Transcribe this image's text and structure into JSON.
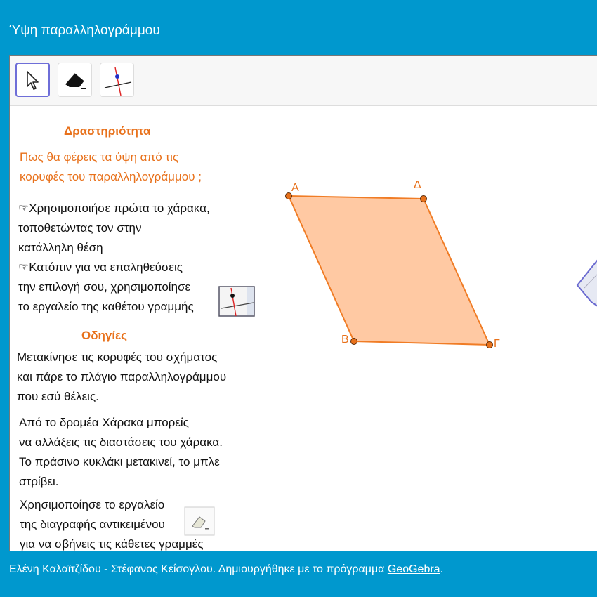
{
  "window": {
    "title": "Ύψη παραλληλογράμμου"
  },
  "toolbar": {
    "tools": [
      {
        "name": "move-tool",
        "icon": "arrow-cursor-icon"
      },
      {
        "name": "delete-tool",
        "icon": "eraser-icon"
      },
      {
        "name": "perpendicular-line-tool",
        "icon": "perpendicular-line-icon"
      }
    ]
  },
  "panel": {
    "heading": "Δραστηριότητα",
    "question_line1": "Πως θα φέρεις τα ύψη από τις",
    "question_line2": "κορυφές του παραλληλογράμμου ;",
    "steps": [
      "☞Χρησιμοποιήσε πρώτα το χάρακα,",
      "τοποθετώντας τον στην",
      "κατάλληλη θέση",
      "☞Κατόπιν για να επαληθεύσεις",
      "την επιλογή σου, χρησιμοποίησε",
      "το εργαλείο της καθέτου γραμμής"
    ],
    "instructions_heading": "Οδηγίες",
    "instr1": [
      "Μετακίνησε τις κορυφές του σχήματος",
      "και πάρε το πλάγιο παραλληλογράμμου",
      "που εσύ θέλεις."
    ],
    "instr2": [
      "Από το δρομέα Χάρακα μπορείς",
      "να αλλάξεις τις διαστάσεις του χάρακα.",
      "Το πράσινο κυκλάκι μετακινεί, το μπλε",
      "στρίβει."
    ],
    "instr3": [
      "Χρησιμοποίησε το εργαλείο",
      "της διαγραφής αντικειμένου",
      "για να σβήνεις τις κάθετες γραμμές"
    ]
  },
  "geometry": {
    "fill_color": "#ffc9a3",
    "stroke_color": "#f07c25",
    "point_color": "#e8711b",
    "labels": {
      "A": "A",
      "D": "Δ",
      "B": "Β",
      "G": "Γ"
    }
  },
  "footer": {
    "text": "Ελένη Καλαϊτζίδου - Στέφανος Κεΐσογλου. Δημιουργήθηκε με το πρόγραμμα ",
    "link": "GeoGebra",
    "end": "."
  }
}
